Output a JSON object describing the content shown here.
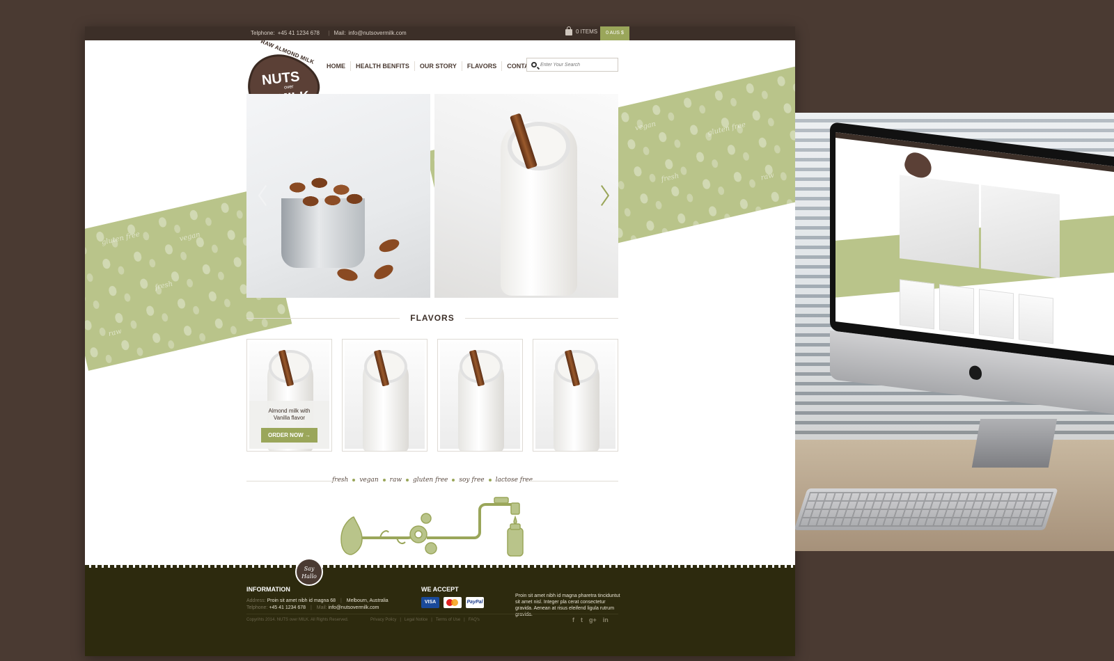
{
  "topbar": {
    "telephone_label": "Telphone:",
    "telephone": "+45 41 1234 678",
    "mail_label": "Mail:",
    "mail": "info@nutsovermilk.com",
    "cart_items": "0 ITEMS",
    "cart_total": "0 AUS $"
  },
  "logo": {
    "arc_text": "RAW ALMOND MILK",
    "word1": "NUTS",
    "word2": "over",
    "word3": "MILK"
  },
  "nav": {
    "items": [
      {
        "label": "HOME"
      },
      {
        "label": "HEALTH BENFITS"
      },
      {
        "label": "OUR STORY"
      },
      {
        "label": "FLAVORS"
      },
      {
        "label": "CONTACT US"
      }
    ]
  },
  "search": {
    "placeholder": "Enter Your Search"
  },
  "pattern_words": [
    "gluten free",
    "vegan",
    "fresh",
    "raw"
  ],
  "flavors": {
    "title": "FLAVORS",
    "featured_name_line1": "Almond milk with",
    "featured_name_line2": "Vanilla flavor",
    "order_button": "ORDER NOW"
  },
  "tagline": [
    "fresh",
    "vegan",
    "raw",
    "gluten free",
    "soy free",
    "lactose free"
  ],
  "footer": {
    "say_hello_line1": "Say",
    "say_hello_line2": "Hallo",
    "information_title": "INFORMATION",
    "address_label": "Address:",
    "address": "Proin sit amet nibh id magna 68",
    "city": "Melbourn, Australia",
    "telephone_label": "Telphone:",
    "telephone": "+45 41 1234 678",
    "mail_label": "Mail:",
    "mail": "info@nutsovermilk.com",
    "accept_title": "WE ACCEPT",
    "payments": [
      "VISA",
      "MasterCard",
      "PayPal"
    ],
    "about": "Proin sit amet nibh id magna pharetra tinciduntut sit amet nisl. Integer pla cerat consectetur gravida. Aenean at risus eleifend ligula rutrum gravida.",
    "copyright": "Copyrihts 2014. NUTS over MILK. All Rights Reserved.",
    "links": [
      "Privacy Policy",
      "Legal Notice",
      "Terms of Use",
      "FAQ's"
    ],
    "social": [
      "f",
      "t",
      "g+",
      "in"
    ]
  },
  "colors": {
    "accent_green": "#9aa65a",
    "band_green": "#b9c48a",
    "brown": "#4a3a32",
    "footer_dark": "#2d2a0e"
  }
}
